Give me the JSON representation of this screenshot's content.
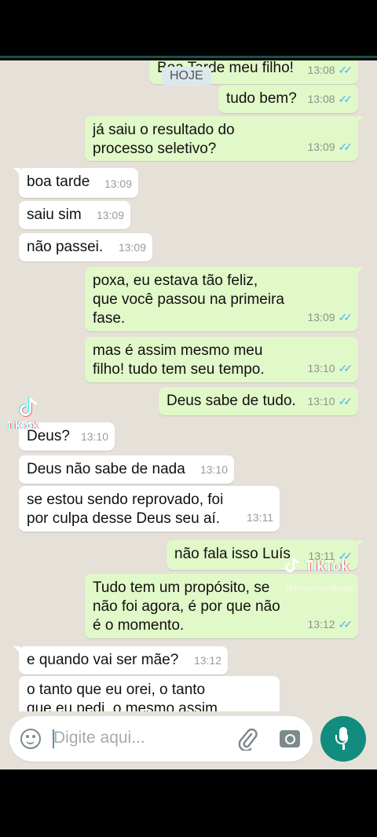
{
  "date_chip": "HOJE",
  "messages": [
    {
      "text": "Boa Tarde meu filho!",
      "time": "13:08"
    },
    {
      "text": "tudo bem?",
      "time": "13:08"
    },
    {
      "text": "já saiu o resultado do\nprocesso seletivo?",
      "time": "13:09"
    },
    {
      "text": "boa tarde",
      "time": "13:09"
    },
    {
      "text": "saiu sim",
      "time": "13:09"
    },
    {
      "text": "não passei.",
      "time": "13:09"
    },
    {
      "text": "poxa, eu estava tão feliz,\nque você passou na primeira\nfase.",
      "time": "13:09"
    },
    {
      "text": "mas é assim mesmo meu\nfilho! tudo tem seu tempo.",
      "time": "13:10"
    },
    {
      "text": "Deus sabe de tudo.",
      "time": "13:10"
    },
    {
      "text": "Deus?",
      "time": "13:10"
    },
    {
      "text": "Deus não sabe de nada",
      "time": "13:10"
    },
    {
      "text": "se estou sendo reprovado, foi\npor culpa desse Deus seu aí.",
      "time": "13:11"
    },
    {
      "text": "não fala isso Luís",
      "time": "13:11"
    },
    {
      "text": "Tudo tem um propósito, se\nnão foi agora, é por que não\né o momento.",
      "time": "13:12"
    },
    {
      "text": "e quando vai ser mãe?",
      "time": "13:12"
    },
    {
      "text": "o tanto que eu orei, o tanto\nque eu pedi, o mesmo assim",
      "time": ""
    }
  ],
  "input": {
    "placeholder": "Digite aqui..."
  },
  "watermark": {
    "brand": "TikTok",
    "handle": "@historiasdezap"
  },
  "colors": {
    "outgoing": "#e1f8c8",
    "incoming": "#ffffff",
    "background": "#e6e1d8",
    "accent": "#128c7e",
    "read_ticks": "#4fb6ec"
  },
  "icons": [
    "emoji-icon",
    "attach-icon",
    "camera-icon",
    "mic-icon",
    "double-check-icon"
  ]
}
